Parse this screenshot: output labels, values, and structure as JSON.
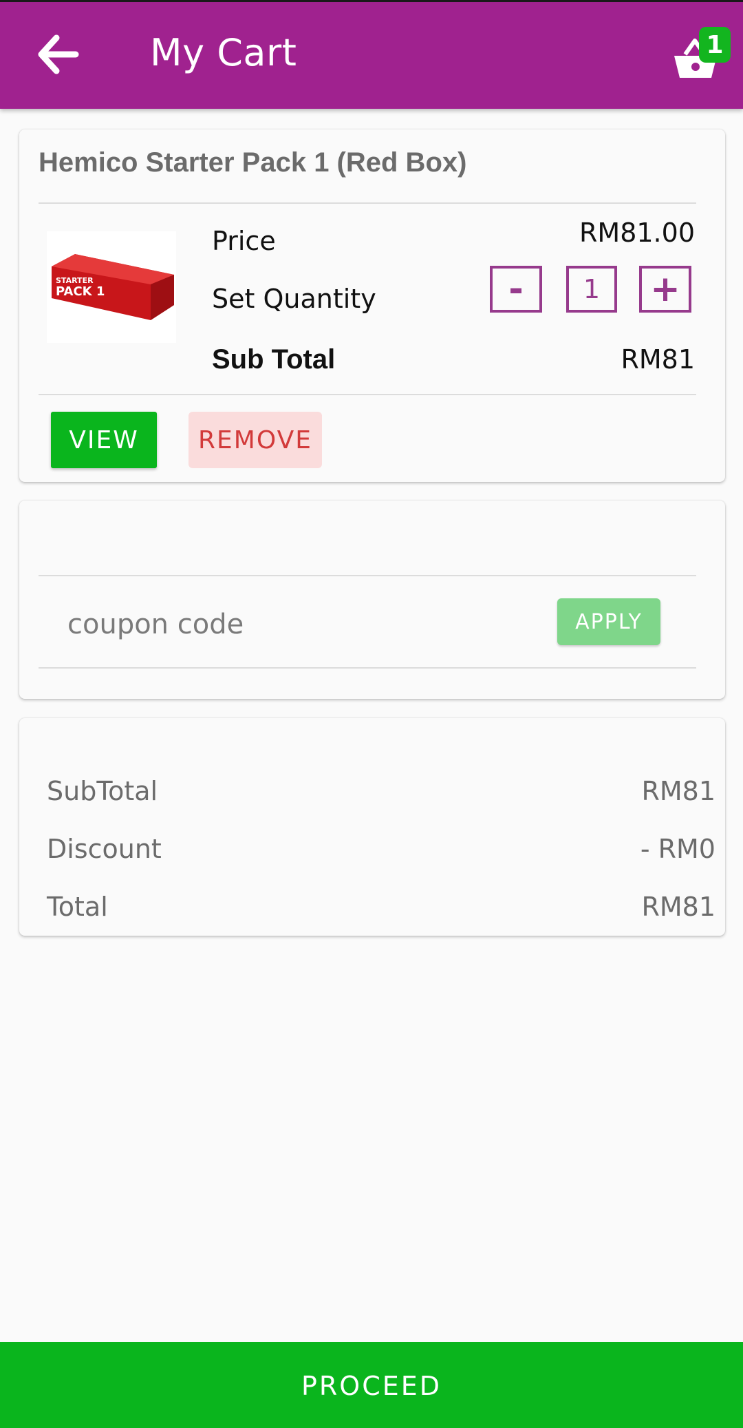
{
  "appbar": {
    "title": "My Cart",
    "cart_count": "1",
    "accent_color": "#a0228f"
  },
  "product": {
    "name": "Hemico Starter Pack 1 (Red Box)",
    "price_label": "Price",
    "price_value": "RM81.00",
    "quantity_label": "Set Quantity",
    "quantity_minus": "-",
    "quantity_value": "1",
    "quantity_plus": "+",
    "subtotal_label": "Sub Total",
    "subtotal_value": "RM81",
    "image_text_line1": "STARTER",
    "image_text_line2": "PACK 1",
    "view_label": "VIEW",
    "remove_label": "REMOVE"
  },
  "coupon": {
    "placeholder": "coupon code",
    "apply_label": "APPLY"
  },
  "summary": {
    "subtotal_label": "SubTotal",
    "subtotal_value": "RM81",
    "discount_label": "Discount",
    "discount_value": "- RM0",
    "total_label": "Total",
    "total_value": "RM81"
  },
  "footer": {
    "proceed_label": "PROCEED",
    "proceed_color": "#0ab51d"
  }
}
